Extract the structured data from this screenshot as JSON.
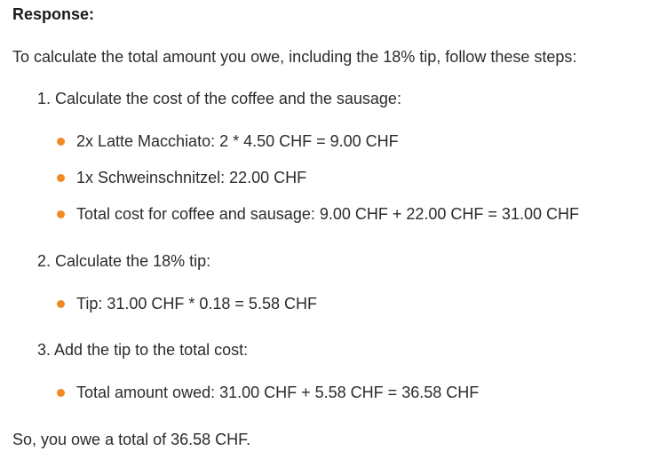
{
  "heading": "Response:",
  "intro": "To calculate the total amount you owe, including the 18% tip, follow these steps:",
  "steps": [
    {
      "label": "1. Calculate the cost of the coffee and the sausage:",
      "bullets": [
        "2x Latte Macchiato: 2 * 4.50 CHF = 9.00 CHF",
        "1x Schweinschnitzel: 22.00 CHF",
        "Total cost for coffee and sausage: 9.00 CHF + 22.00 CHF = 31.00 CHF"
      ]
    },
    {
      "label": "2. Calculate the 18% tip:",
      "bullets": [
        "Tip: 31.00 CHF * 0.18 = 5.58 CHF"
      ]
    },
    {
      "label": "3. Add the tip to the total cost:",
      "bullets": [
        "Total amount owed: 31.00 CHF + 5.58 CHF = 36.58 CHF"
      ]
    }
  ],
  "conclusion": "So, you owe a total of 36.58 CHF.",
  "colors": {
    "bullet": "#f08a24",
    "text": "#2b2b2b"
  }
}
